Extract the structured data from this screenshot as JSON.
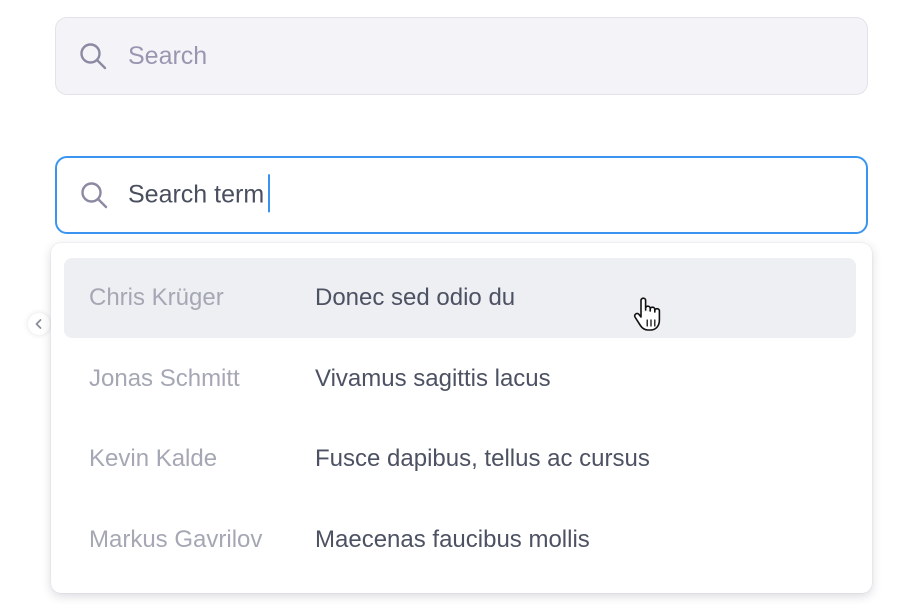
{
  "search_idle": {
    "placeholder": "Search",
    "icon": "search-icon"
  },
  "search_active": {
    "value": "Search term",
    "icon": "search-icon",
    "focus_color": "#3b95f0"
  },
  "results": [
    {
      "name": "Chris Krüger",
      "description": "Donec sed odio du",
      "highlighted": true
    },
    {
      "name": "Jonas Schmitt",
      "description": "Vivamus sagittis lacus",
      "highlighted": false
    },
    {
      "name": "Kevin Kalde",
      "description": "Fusce dapibus, tellus ac cursus",
      "highlighted": false
    },
    {
      "name": "Markus Gavrilov",
      "description": "Maecenas faucibus mollis",
      "highlighted": false
    }
  ],
  "colors": {
    "highlight_bg": "#eeeff3",
    "name_text": "#a5a8b4",
    "description_text": "#4d5263"
  }
}
